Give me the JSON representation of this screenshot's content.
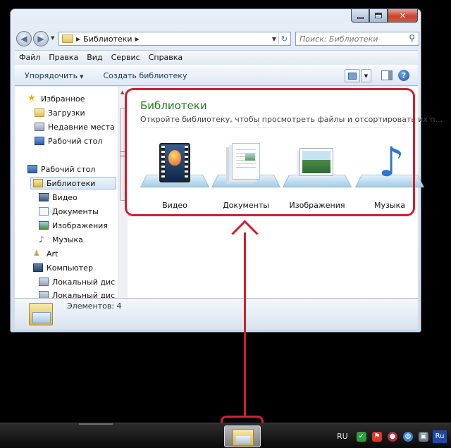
{
  "window": {
    "address": {
      "path": "Библиотеки"
    },
    "search": {
      "placeholder": "Поиск: Библиотеки"
    },
    "menu": [
      "Файл",
      "Правка",
      "Вид",
      "Сервис",
      "Справка"
    ],
    "commands": {
      "organize": "Упорядочить",
      "create_library": "Создать библиотеку"
    },
    "sidebar": [
      {
        "label": "Избранное",
        "icon": "star-icon"
      },
      {
        "label": "Загрузки",
        "icon": "downloads-folder-icon"
      },
      {
        "label": "Недавние места",
        "icon": "recent-places-icon"
      },
      {
        "label": "Рабочий стол",
        "icon": "desktop-icon"
      },
      {
        "label": "Рабочий стол",
        "icon": "desktop-icon"
      },
      {
        "label": "Библиотеки",
        "icon": "libraries-icon",
        "selected": true
      },
      {
        "label": "Видео",
        "icon": "video-library-icon"
      },
      {
        "label": "Документы",
        "icon": "documents-library-icon"
      },
      {
        "label": "Изображения",
        "icon": "pictures-library-icon"
      },
      {
        "label": "Музыка",
        "icon": "music-library-icon"
      },
      {
        "label": "Art",
        "icon": "user-folder-icon"
      },
      {
        "label": "Компьютер",
        "icon": "computer-icon"
      },
      {
        "label": "Локальный дис",
        "icon": "hard-drive-icon"
      },
      {
        "label": "Локальный дис",
        "icon": "hard-drive-icon"
      }
    ],
    "main": {
      "title": "Библиотеки",
      "subtitle": "Откройте библиотеку, чтобы просмотреть файлы и отсортировать их п...",
      "libraries": [
        {
          "label": "Видео",
          "icon": "video-library-icon"
        },
        {
          "label": "Документы",
          "icon": "documents-library-icon"
        },
        {
          "label": "Изображения",
          "icon": "pictures-library-icon"
        },
        {
          "label": "Музыка",
          "icon": "music-library-icon"
        }
      ]
    },
    "status": {
      "count_text": "Элементов: 4"
    }
  },
  "taskbar": {
    "language": "RU",
    "lang_indicator": "Ru"
  },
  "colors": {
    "annotation": "#d31f2e",
    "title_green": "#1e7a1e"
  }
}
